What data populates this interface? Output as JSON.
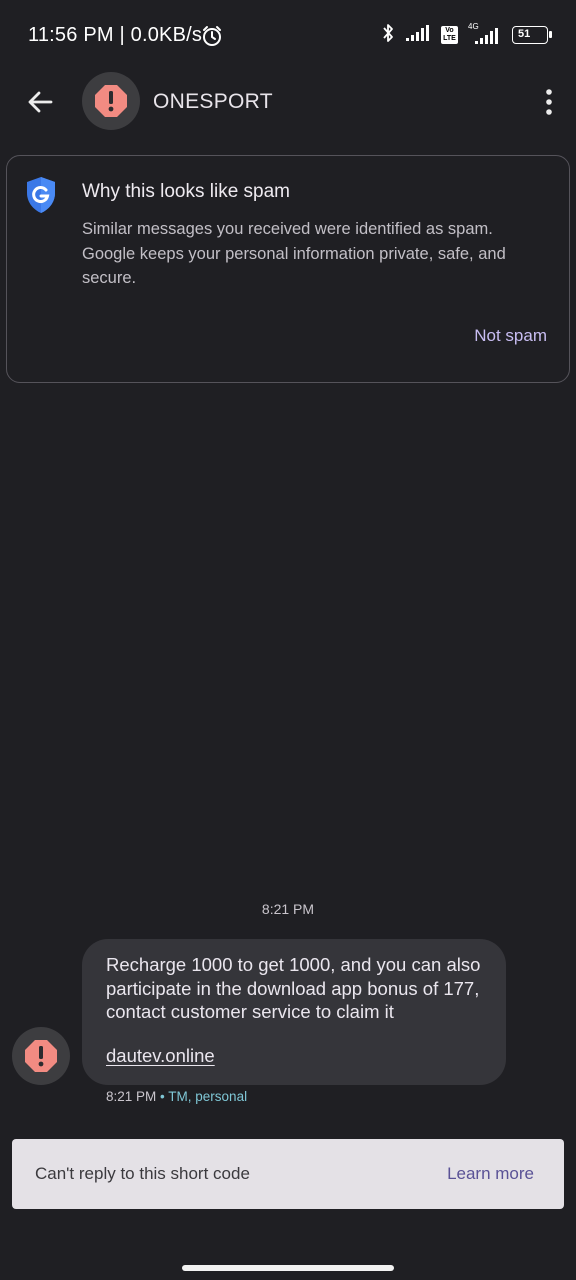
{
  "status_bar": {
    "time_speed": "11:56 PM | 0.0KB/s",
    "volte_label": "Vo LTE",
    "network_label": "4G",
    "battery": "51"
  },
  "header": {
    "contact_name": "ONESPORT"
  },
  "spam_card": {
    "title": "Why this looks like spam",
    "body": "Similar messages you received were identified as spam. Google keeps your personal information private, safe, and secure.",
    "action": "Not spam"
  },
  "conversation": {
    "timestamp": "8:21 PM",
    "message": {
      "text": "Recharge 1000 to get 1000, and you can also participate in the download app bonus of 177, contact customer service to claim it",
      "link": "dautev.online",
      "time": "8:21 PM",
      "separator": "•",
      "tag": "TM, personal"
    }
  },
  "reply_bar": {
    "text": "Can't reply to this short code",
    "action": "Learn more"
  },
  "colors": {
    "background": "#1f1f23",
    "spam_icon": "#f28b82",
    "accent": "#c8bdf2",
    "link_tag": "#7fc7d6"
  }
}
